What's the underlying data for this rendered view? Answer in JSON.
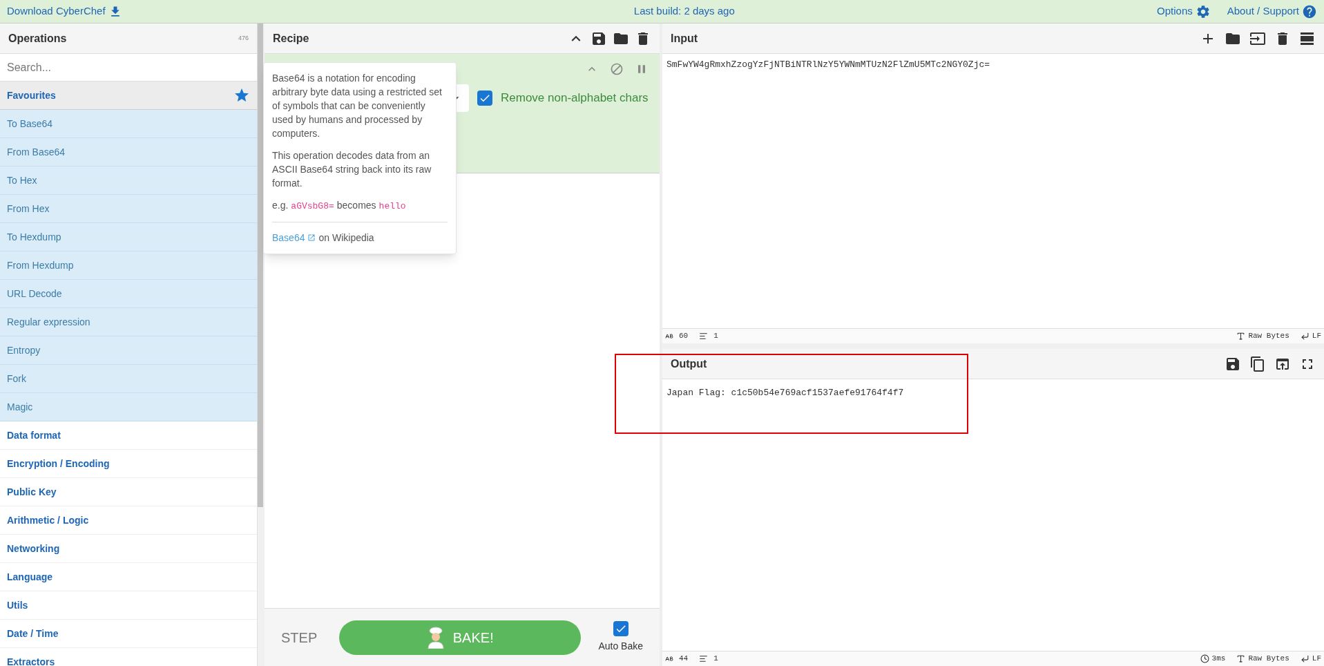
{
  "top_bar": {
    "download": "Download CyberChef",
    "build": "Last build: 2 days ago",
    "options": "Options",
    "about": "About / Support"
  },
  "operations": {
    "title": "Operations",
    "count": "476",
    "search_placeholder": "Search...",
    "categories": [
      {
        "label": "Favourites",
        "expanded": true,
        "children": [
          {
            "label": "To Base64"
          },
          {
            "label": "From Base64"
          },
          {
            "label": "To Hex"
          },
          {
            "label": "From Hex"
          },
          {
            "label": "To Hexdump"
          },
          {
            "label": "From Hexdump"
          },
          {
            "label": "URL Decode"
          },
          {
            "label": "Regular expression"
          },
          {
            "label": "Entropy"
          },
          {
            "label": "Fork"
          },
          {
            "label": "Magic"
          }
        ]
      },
      {
        "label": "Data format",
        "expanded": false
      },
      {
        "label": "Encryption / Encoding",
        "expanded": false
      },
      {
        "label": "Public Key",
        "expanded": false
      },
      {
        "label": "Arithmetic / Logic",
        "expanded": false
      },
      {
        "label": "Networking",
        "expanded": false
      },
      {
        "label": "Language",
        "expanded": false
      },
      {
        "label": "Utils",
        "expanded": false
      },
      {
        "label": "Date / Time",
        "expanded": false
      },
      {
        "label": "Extractors",
        "expanded": false
      }
    ]
  },
  "recipe": {
    "title": "Recipe",
    "option": {
      "label": "Remove non-alphabet chars",
      "checked": true
    }
  },
  "popover": {
    "intro": "Base64 is a notation for encoding arbitrary byte data using a restricted set of symbols that can be conveniently used by humans and processed by computers.",
    "description": "This operation decodes data from an ASCII Base64 string back into its raw format.",
    "example_prefix": "e.g.",
    "example_input": "aGVsbG8=",
    "example_mid": "becomes",
    "example_output": "hello",
    "link": "Base64",
    "link_suffix": "on Wikipedia"
  },
  "bake": {
    "step": "STEP",
    "button": "BAKE!",
    "auto_bake": {
      "label": "Auto Bake",
      "checked": true
    }
  },
  "input": {
    "title": "Input",
    "value": "SmFwYW4gRmxhZzogYzFjNTBiNTRlNzY5YWNmMTUzN2FlZmU5MTc2NGY0Zjc=",
    "status": {
      "length": "60",
      "lines": "1",
      "encoding": "Raw Bytes",
      "eol": "LF"
    }
  },
  "output": {
    "title": "Output",
    "value": "Japan Flag: c1c50b54e769acf1537aefe91764f4f7",
    "status": {
      "length": "44",
      "lines": "1",
      "time": "3ms",
      "encoding": "Raw Bytes",
      "eol": "LF"
    }
  }
}
